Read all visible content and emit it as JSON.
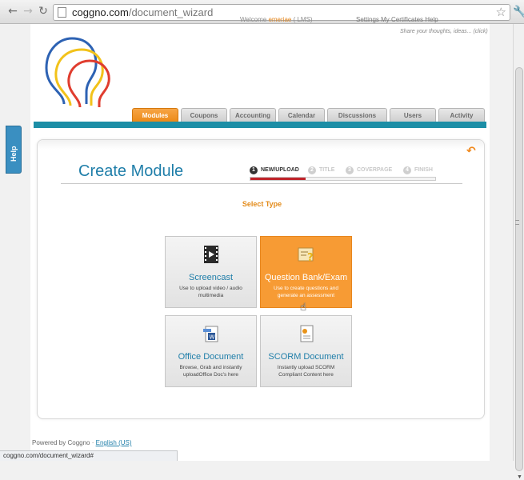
{
  "browser": {
    "url_host": "coggno.com",
    "url_path": "/document_wizard"
  },
  "header": {
    "welcome_prefix": "Welcome",
    "user_name": "emeriae",
    "user_suffix": "( LMS)",
    "menu_text": "Settings  My Certificates  Help",
    "feedback": "Share your thoughts, ideas... (click)"
  },
  "tabs": [
    {
      "label": "Modules",
      "active": true
    },
    {
      "label": "Coupons",
      "active": false
    },
    {
      "label": "Accounting",
      "active": false
    },
    {
      "label": "Calendar",
      "active": false
    },
    {
      "label": "Discussions",
      "active": false
    },
    {
      "label": "Users",
      "active": false
    },
    {
      "label": "Activity",
      "active": false
    }
  ],
  "help_tab": "Help",
  "main": {
    "title": "Create Module",
    "select_type": "Select Type",
    "steps": [
      {
        "num": "1",
        "label": "NEW/UPLOAD",
        "active": true
      },
      {
        "num": "2",
        "label": "TITLE",
        "active": false
      },
      {
        "num": "3",
        "label": "COVERPAGE",
        "active": false
      },
      {
        "num": "4",
        "label": "FINISH",
        "active": false
      }
    ],
    "progress_fraction": 0.3
  },
  "cards": [
    {
      "title": "Screencast",
      "desc": "Use to upload video / audio multimedia",
      "icon": "film-play-icon",
      "active": false
    },
    {
      "title": "Question Bank/Exam",
      "desc": "Use to create questions and generate an assessment",
      "icon": "question-bank-icon",
      "active": true
    },
    {
      "title": "Office Document",
      "desc": "Browse, Grab and instantly uploadOffice Doc's here",
      "icon": "office-document-icon",
      "active": false
    },
    {
      "title": "SCORM Document",
      "desc": "Instantly upload SCORM Compliant Content here",
      "icon": "scorm-document-icon",
      "active": false
    }
  ],
  "footer": {
    "powered": "Powered by Coggno · ",
    "language": "English (US)"
  },
  "status_bar": "coggno.com/document_wizard#",
  "colors": {
    "accent_orange": "#f79b34",
    "brand_blue": "#1f7ea9",
    "navbar_teal": "#1c8ea6"
  }
}
